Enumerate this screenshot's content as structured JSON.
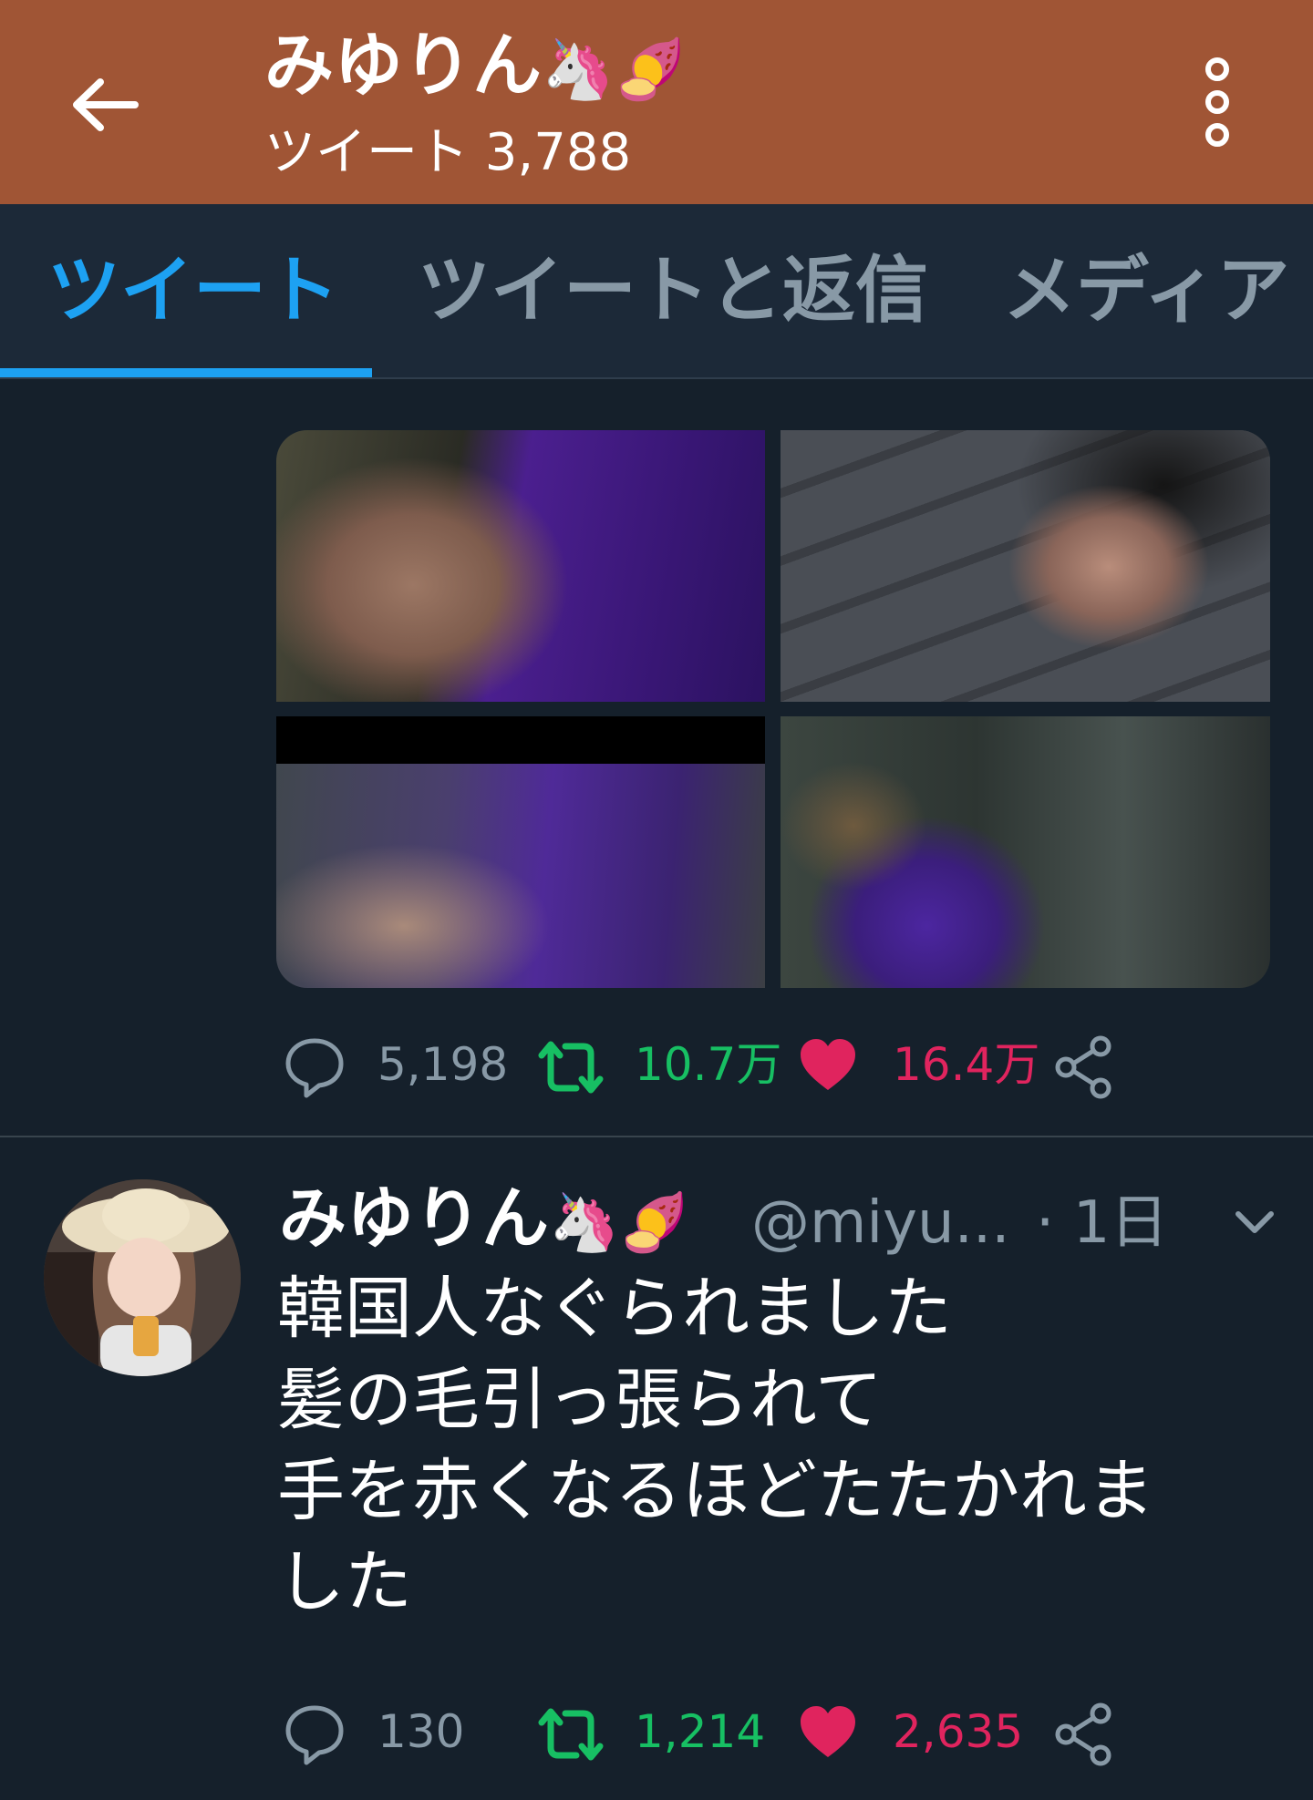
{
  "header": {
    "name": "みゆりん",
    "name_emoji": "🦄🍠",
    "tweet_count": "ツイート 3,788",
    "bg_color": "#a05535"
  },
  "tabs": [
    {
      "label": "ツイート",
      "active": true
    },
    {
      "label": "ツイートと返信",
      "active": false
    },
    {
      "label": "メディア",
      "active": false
    }
  ],
  "tweet1": {
    "media_count": 4,
    "replies": "5,198",
    "retweets": "10.7万",
    "likes": "16.4万"
  },
  "tweet2": {
    "name": "みゆりん",
    "name_emoji": "🦄🍠",
    "handle": "@miyu...",
    "time": "· 1日",
    "text": "韓国人なぐられました\n髪の毛引っ張られて\n手を赤くなるほどたたかれま\nした",
    "replies": "130",
    "retweets": "1,214",
    "likes": "2,635"
  },
  "colors": {
    "background": "#15202b",
    "tab_bar": "#1c2938",
    "accent": "#1da1f2",
    "retweet": "#17bf63",
    "like": "#e0245e",
    "secondary": "#8899a6"
  },
  "icons": [
    "back-arrow-icon",
    "more-vertical-icon",
    "reply-icon",
    "retweet-icon",
    "heart-icon",
    "share-icon",
    "chevron-down-icon"
  ]
}
